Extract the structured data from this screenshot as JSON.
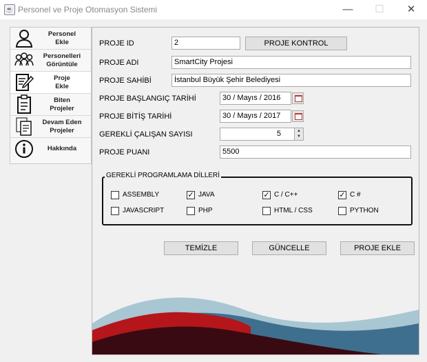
{
  "window": {
    "title": "Personel ve Proje Otomasyon Sistemi",
    "minimize": "—",
    "maximize": "☐",
    "close": "✕"
  },
  "sidebar": {
    "items": [
      {
        "label": "Personel\nEkle",
        "icon": "user-icon"
      },
      {
        "label": "Personelleri\nGörüntüle",
        "icon": "users-icon"
      },
      {
        "label": "Proje\nEkle",
        "icon": "edit-document-icon",
        "active": true
      },
      {
        "label": "Biten\nProjeler",
        "icon": "clipboard-icon"
      },
      {
        "label": "Devam Eden\nProjeler",
        "icon": "documents-icon"
      },
      {
        "label": "Hakkında",
        "icon": "info-icon"
      }
    ]
  },
  "form": {
    "proje_id": {
      "label": "PROJE ID",
      "value": "2"
    },
    "proje_kontrol": "PROJE KONTROL",
    "proje_adi": {
      "label": "PROJE ADI",
      "value": "SmartCity Projesi"
    },
    "proje_sahibi": {
      "label": "PROJE SAHİBİ",
      "value": "İstanbul Büyük Şehir Belediyesi"
    },
    "baslangic": {
      "label": "PROJE BAŞLANGIÇ TARİHİ",
      "value": "30 / Mayıs / 2016"
    },
    "bitis": {
      "label": "PROJE BİTİŞ TARİHİ",
      "value": "30 / Mayıs / 2017"
    },
    "calisan": {
      "label": "GEREKLİ ÇALIŞAN SAYISI",
      "value": "5"
    },
    "puan": {
      "label": "PROJE PUANI",
      "value": "5500"
    }
  },
  "languages": {
    "title": "GEREKLİ PROGRAMLAMA DİLLERİ",
    "items": [
      {
        "label": "ASSEMBLY",
        "checked": false
      },
      {
        "label": "JAVA",
        "checked": true
      },
      {
        "label": "C / C++",
        "checked": true
      },
      {
        "label": "C #",
        "checked": true
      },
      {
        "label": "JAVASCRIPT",
        "checked": false
      },
      {
        "label": "PHP",
        "checked": false
      },
      {
        "label": "HTML / CSS",
        "checked": false
      },
      {
        "label": "PYTHON",
        "checked": false
      }
    ]
  },
  "actions": {
    "temizle": "TEMİZLE",
    "guncelle": "GÜNCELLE",
    "ekle": "PROJE EKLE"
  },
  "check_mark": "✓",
  "colors": {
    "accent_red": "#b5161b",
    "dark_red": "#3a0a12",
    "steel_blue": "#3f6f8f",
    "light_blue": "#a9c6d3"
  }
}
